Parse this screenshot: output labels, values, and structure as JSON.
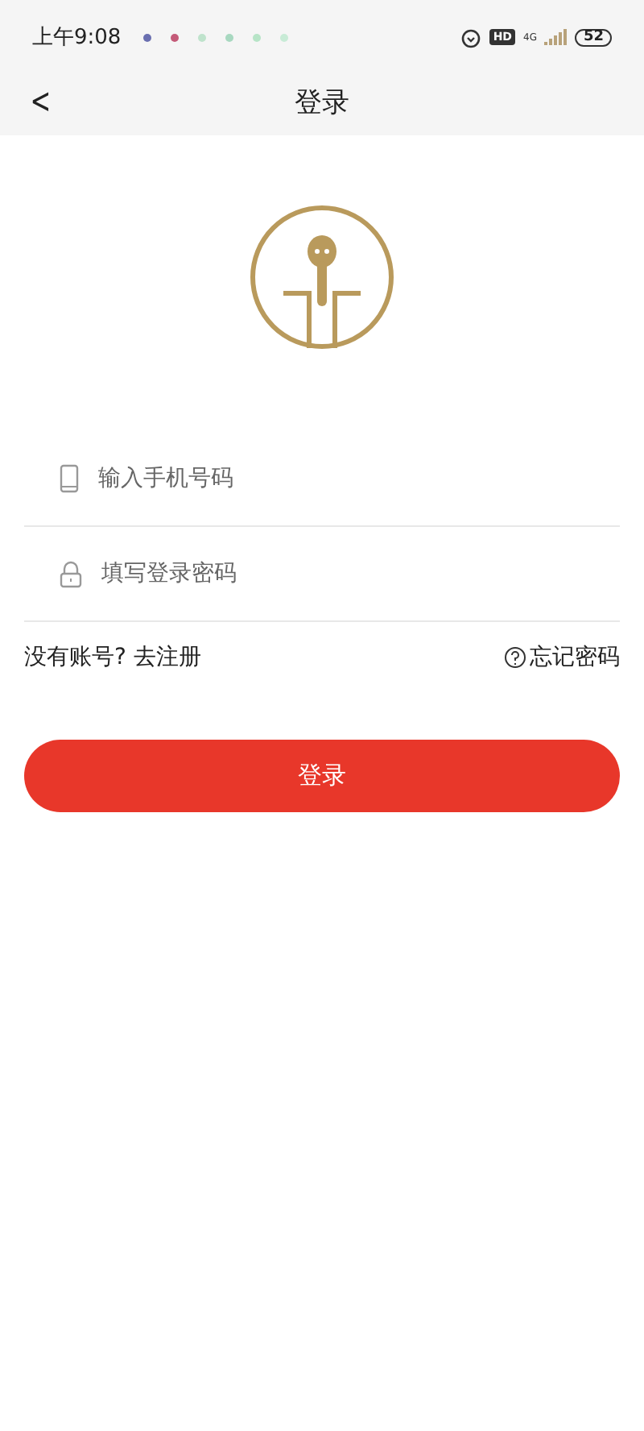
{
  "status_bar": {
    "time": "上午9:08",
    "hd": "HD",
    "network": "4G",
    "battery": "52"
  },
  "header": {
    "back": "<",
    "title": "登录"
  },
  "form": {
    "phone": {
      "placeholder": "输入手机号码"
    },
    "password": {
      "placeholder": "填写登录密码"
    }
  },
  "links": {
    "register": "没有账号? 去注册",
    "forgot": "忘记密码"
  },
  "submit": "登录"
}
